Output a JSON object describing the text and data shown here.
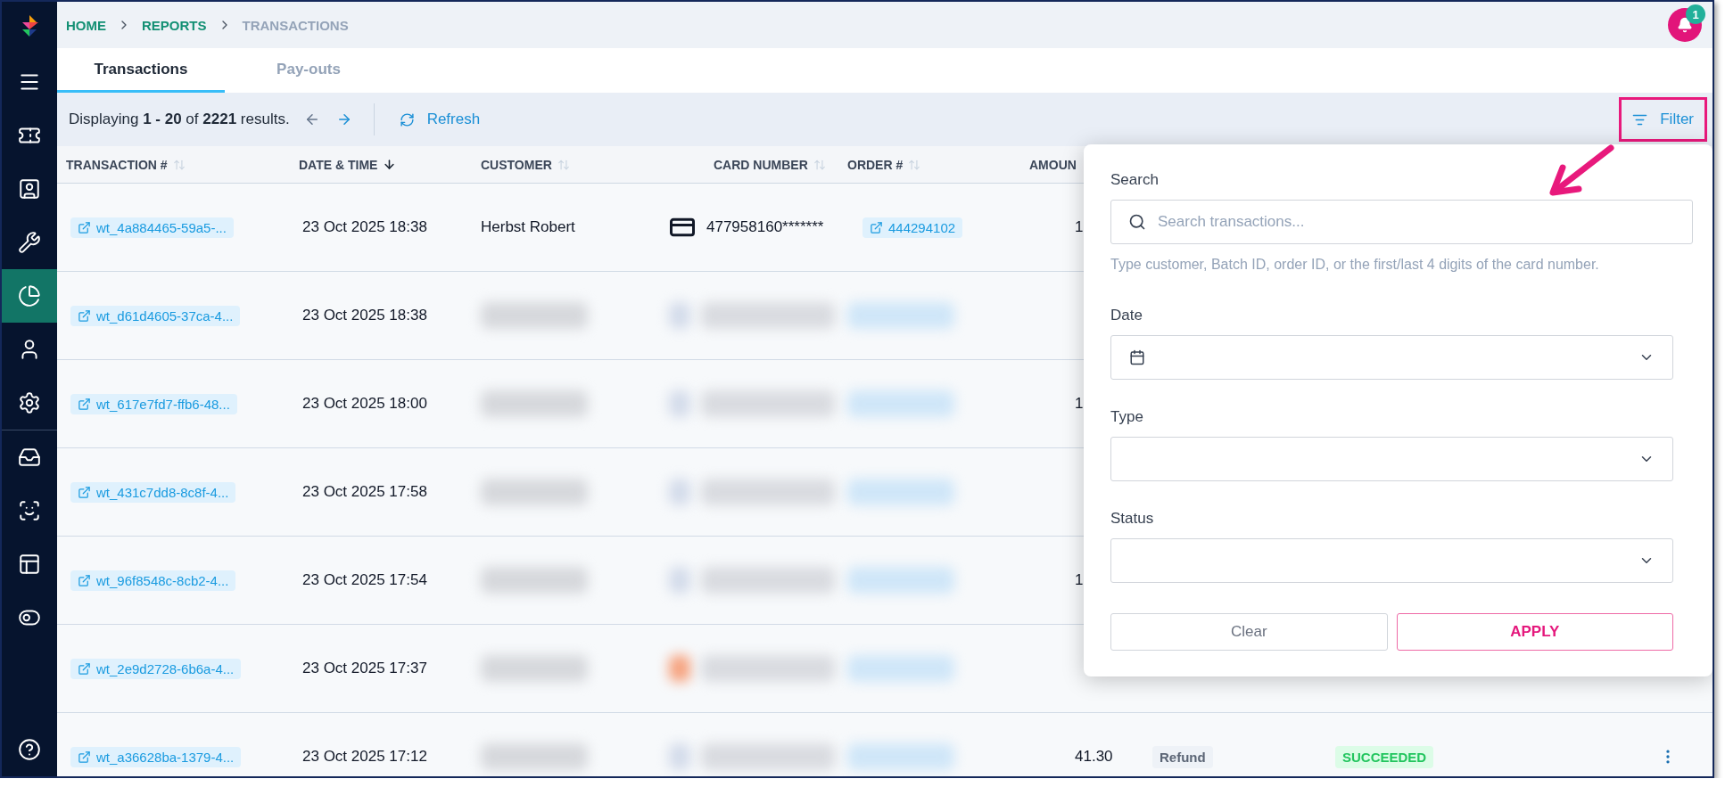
{
  "breadcrumb": [
    {
      "label": "HOME",
      "current": false
    },
    {
      "label": "REPORTS",
      "current": false
    },
    {
      "label": "TRANSACTIONS",
      "current": true
    }
  ],
  "notifications": {
    "count": "1"
  },
  "sidebar": {
    "items": [
      {
        "kind": "menu",
        "selected": false
      },
      {
        "kind": "ticket",
        "selected": false
      },
      {
        "kind": "contact",
        "selected": false
      },
      {
        "kind": "wrench",
        "selected": false
      },
      {
        "kind": "chart",
        "selected": true
      },
      {
        "kind": "user",
        "selected": false
      },
      {
        "kind": "settings",
        "selected": false
      },
      {
        "kind": "inbox",
        "selected": false
      },
      {
        "kind": "scan",
        "selected": false
      },
      {
        "kind": "board",
        "selected": false
      },
      {
        "kind": "toggle",
        "selected": false
      }
    ]
  },
  "tabs": [
    {
      "label": "Transactions",
      "selected": true
    },
    {
      "label": "Pay-outs",
      "selected": false
    }
  ],
  "toolbar": {
    "summary": "Displaying **1 - 20** of **2221** results.",
    "previous": {
      "disabled": true
    },
    "next": {
      "disabled": false
    },
    "refresh": "Refresh",
    "filter": "Filter"
  },
  "table": {
    "columns": [
      {
        "label": "TRANSACTION #",
        "sorted": false
      },
      {
        "label": "DATE & TIME",
        "sorted": true
      },
      {
        "label": "CUSTOMER",
        "sorted": false
      },
      {
        "label": "CARD NUMBER",
        "sorted": false
      },
      {
        "label": "ORDER #",
        "sorted": false
      },
      {
        "label": "AMOUN"
      }
    ],
    "rows": [
      {
        "transaction": "wt_4a884465-59a5-...",
        "date": "23 Oct 2025 18:38",
        "customer": "Herbst Robert",
        "card": "477958160*******",
        "order": "444294102",
        "amount": "1"
      },
      {
        "transaction": "wt_d61d4605-37ca-4...",
        "date": "23 Oct 2025 18:38",
        "redacted": true
      },
      {
        "transaction": "wt_617e7fd7-ffb6-48...",
        "date": "23 Oct 2025 18:00",
        "redacted": true,
        "amount": "1"
      },
      {
        "transaction": "wt_431c7dd8-8c8f-4...",
        "date": "23 Oct 2025 17:58",
        "redacted": true
      },
      {
        "transaction": "wt_96f8548c-8cb2-4...",
        "date": "23 Oct 2025 17:54",
        "redacted": true,
        "amount": "1"
      },
      {
        "transaction": "wt_2e9d2728-6b6a-4...",
        "date": "23 Oct 2025 17:37",
        "redacted": true,
        "color": "#f6a27e"
      },
      {
        "transaction": "wt_a36628ba-1379-4...",
        "date": "23 Oct 2025 17:12",
        "redacted": true,
        "amount": "41.30",
        "type": "Refund",
        "status": "SUCCEEDED"
      }
    ]
  },
  "filter_panel": {
    "search": {
      "label": "Search",
      "placeholder": "Search transactions...",
      "hint": "Type customer, Batch ID, order ID, or the first/last 4 digits of the card number."
    },
    "fields": [
      {
        "label": "Date",
        "kind": "date"
      },
      {
        "label": "Type",
        "kind": "select"
      },
      {
        "label": "Status",
        "kind": "select"
      }
    ],
    "clear": "Clear",
    "apply": "APPLY"
  }
}
